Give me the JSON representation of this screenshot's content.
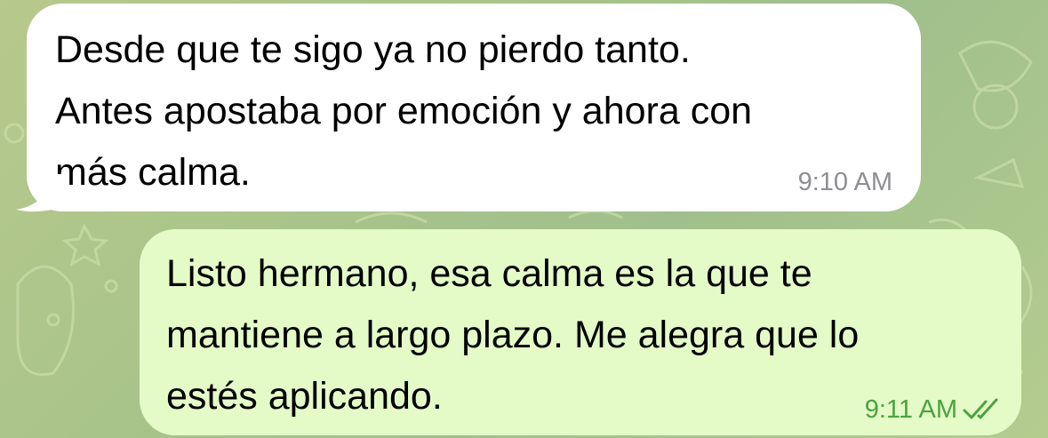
{
  "messages": [
    {
      "direction": "incoming",
      "text": "Desde que te sigo ya no pierdo tanto.\nAntes apostaba por emoción y ahora con\nmás calma.",
      "time": "9:10 AM"
    },
    {
      "direction": "outgoing",
      "text": "Listo hermano, esa calma es la que te\nmantiene a largo plazo. Me alegra que lo\nestés aplicando.",
      "time": "9:11 AM",
      "status_icon": "double-check-icon"
    }
  ],
  "colors": {
    "incoming_bubble": "#ffffff",
    "outgoing_bubble": "#e4fbc8",
    "incoming_time": "#8e8e93",
    "outgoing_time": "#4aa33f",
    "wallpaper": "#a9c48a"
  }
}
